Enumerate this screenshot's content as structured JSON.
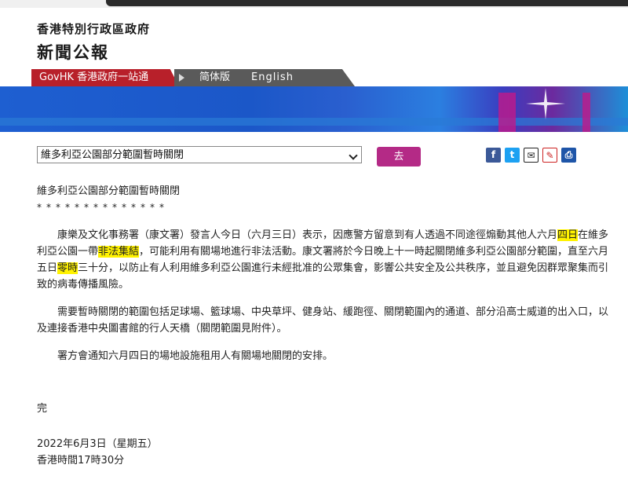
{
  "header": {
    "hk_gov": "香港特別行政區政府",
    "press_releases": "新聞公報"
  },
  "nav": {
    "govhk": "GovHK 香港政府一站通",
    "simplified": "简体版",
    "english": "English"
  },
  "selector": {
    "selected": "維多利亞公園部分範圍暫時關閉",
    "go_label": "去"
  },
  "share_icons": {
    "facebook": "f",
    "twitter": "t",
    "mail": "✉",
    "pdf": "✎",
    "print": "⎙"
  },
  "article": {
    "title": "維多利亞公園部分範圍暫時關閉",
    "stars": "**************",
    "p1_a": "康樂及文化事務署（康文署）發言人今日（六月三日）表示，因應警方留意到有人透過不同途徑煽動其他人六月",
    "p1_hl1": "四日",
    "p1_b": "在維多利亞公園一帶",
    "p1_hl2": "非法集結",
    "p1_c": "，可能利用有關場地進行非法活動。康文署將於今日晚上十一時起關閉維多利亞公園部分範圍，直至六月五日",
    "p1_hl3": "零時",
    "p1_d": "三十分，以防止有人利用維多利亞公園進行未經批准的公眾集會，影響公共安全及公共秩序，並且避免因群眾聚集而引致的病毒傳播風險。",
    "p2": "需要暫時關閉的範圍包括足球場、籃球場、中央草坪、健身站、緩跑徑、關閉範圍內的通道、部分沿高士威道的出入口，以及連接香港中央圖書館的行人天橋（關閉範圍見附件）。",
    "p3": "署方會通知六月四日的場地設施租用人有關場地關閉的安排。",
    "end": "完",
    "date": "2022年6月3日（星期五）",
    "time": "香港時間17時30分"
  }
}
